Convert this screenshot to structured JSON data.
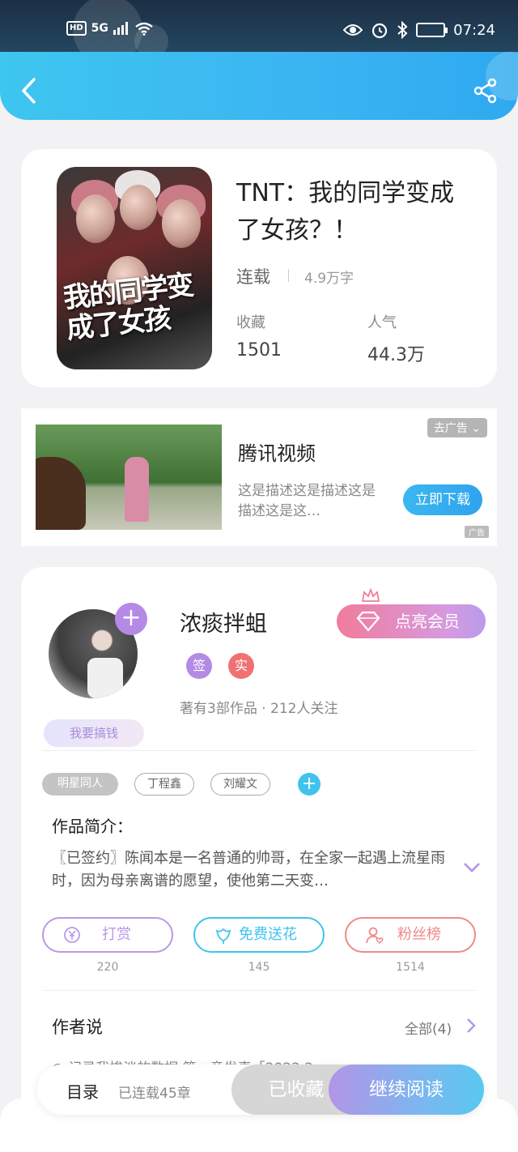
{
  "status_bar": {
    "network_badge": "HD",
    "network_type": "5G",
    "time": "07:24",
    "icons": [
      "signal-icon",
      "wifi-icon",
      "eye-icon",
      "alarm-icon",
      "bluetooth-icon",
      "battery-icon"
    ]
  },
  "nav": {
    "back_icon": "chevron-left-icon",
    "share_icon": "share-icon"
  },
  "book": {
    "title": "TNT：我的同学变成了女孩？！",
    "cover_text": "我的同学变成了女孩",
    "status": "连载",
    "word_count": "4.9万字",
    "stats": [
      {
        "label": "收藏",
        "value": "1501"
      },
      {
        "label": "人气",
        "value": "44.3万"
      }
    ]
  },
  "ad": {
    "title": "腾讯视频",
    "description": "这是描述这是描述这是描述这是这…",
    "tag": "去广告",
    "button": "立即下载",
    "mark": "广告"
  },
  "author": {
    "name": "浓痰拌蛆",
    "badges": [
      {
        "text": "签",
        "color": "#b48ae4"
      },
      {
        "text": "实",
        "color": "#f07171"
      }
    ],
    "stats": "著有3部作品 · 212人关注",
    "money_tag": "我要搞钱",
    "vip_button": "点亮会员",
    "add_icon": "plus-icon"
  },
  "tags": [
    "明星同人",
    "丁程鑫",
    "刘耀文"
  ],
  "intro": {
    "heading": "作品简介：",
    "text": "〖已签约〗陈闻本是一名普通的帅哥，在全家一起遇上流星雨时，因为母亲离谱的愿望，使他第二天变…"
  },
  "actions": [
    {
      "label": "打赏",
      "count": "220",
      "color": "#b89ae4",
      "icon": "yen-coin-icon"
    },
    {
      "label": "免费送花",
      "count": "145",
      "color": "#3fc3ee",
      "icon": "flower-icon"
    },
    {
      "label": "粉丝榜",
      "count": "1514",
      "color": "#ef8a8a",
      "icon": "fan-user-icon"
    }
  ],
  "author_says": {
    "heading": "作者说",
    "all_label": "全部(4)",
    "preview": "◎ 记录我惨淡的数据 第一章发表「2022.2…"
  },
  "bottom_bar": {
    "toc_label": "目录",
    "toc_count": "已连载45章",
    "collected": "已收藏",
    "continue": "继续阅读"
  },
  "colors": {
    "primary_blue": "#3bb4f2",
    "vip_pink": "#f17c9b",
    "purple": "#b295e7"
  }
}
